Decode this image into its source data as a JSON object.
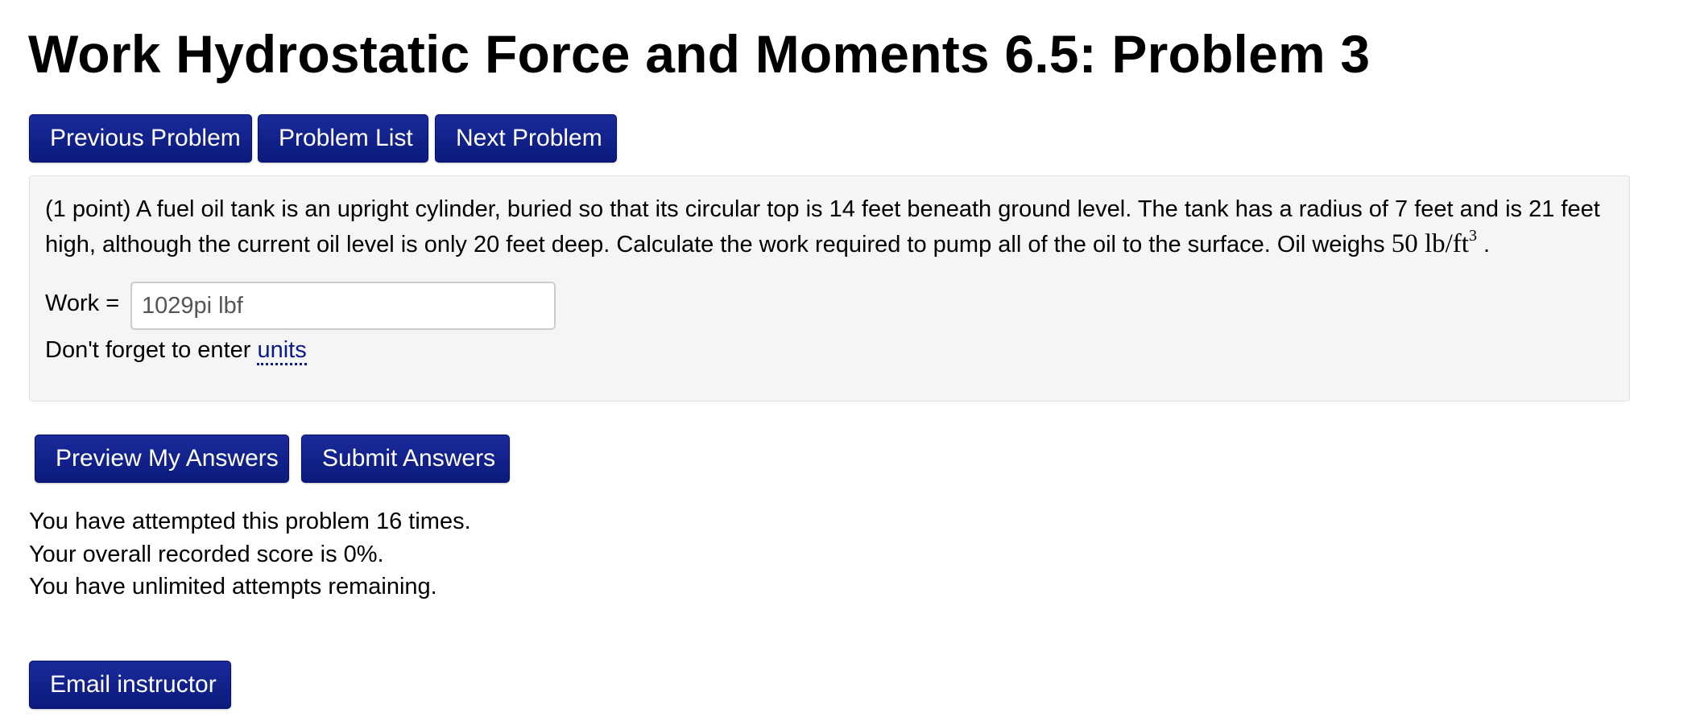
{
  "page": {
    "title": "Work Hydrostatic Force and Moments 6.5: Problem 3"
  },
  "nav": {
    "previous_label": "Previous Problem",
    "list_label": "Problem List",
    "next_label": "Next Problem"
  },
  "problem": {
    "text": "(1 point) A fuel oil tank is an upright cylinder, buried so that its circular top is 14 feet beneath ground level. The tank has a radius of 7 feet and is 21 feet high, although the current oil level is only 20 feet deep. Calculate the work required to pump all of the oil to the surface. Oil weighs ",
    "math_value": "50 lb/ft",
    "math_exponent": "3",
    "text_end": ".",
    "work_label": "Work =",
    "answer_value": "1029pi lbf",
    "units_prefix": "Don't forget to enter ",
    "units_link": "units"
  },
  "actions": {
    "preview_label": "Preview My Answers",
    "submit_label": "Submit Answers"
  },
  "status": {
    "attempts": "You have attempted this problem 16 times.",
    "score": "Your overall recorded score is 0%.",
    "remaining": "You have unlimited attempts remaining."
  },
  "footer": {
    "email_label": "Email instructor"
  },
  "colors": {
    "button_bg": "#0e1d82",
    "link": "#0a1a8a",
    "panel_bg": "#f5f5f5"
  }
}
